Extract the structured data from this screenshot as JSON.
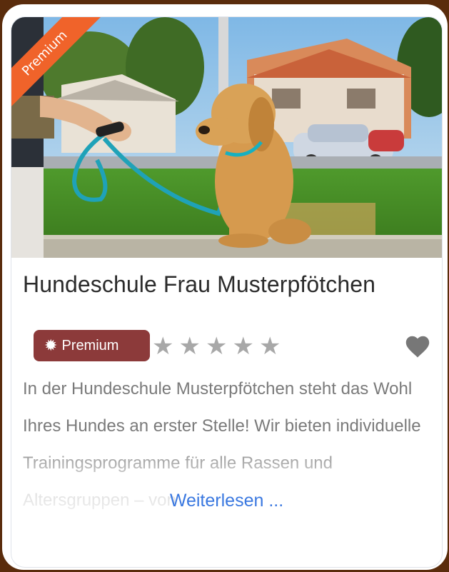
{
  "card": {
    "ribbon_label": "Premium",
    "title": "Hundeschule Frau Musterpfötchen",
    "badge": {
      "icon": "badge-star-icon",
      "label": "Premium",
      "color": "#8c3a3a"
    },
    "rating": {
      "value": 0,
      "max": 5,
      "star_color": "#a8a8a8"
    },
    "favorite_icon": "heart-icon",
    "description": "In der Hundeschule Musterpfötchen steht das Wohl Ihres Hundes an erster Stelle! Wir bieten individuelle Trainingsprogramme für alle Rassen und Altersgruppen – von",
    "read_more": "Weiterlesen ...",
    "colors": {
      "ribbon": "#f0632a",
      "link": "#3a78e0",
      "frame": "#5a2c0c"
    }
  }
}
